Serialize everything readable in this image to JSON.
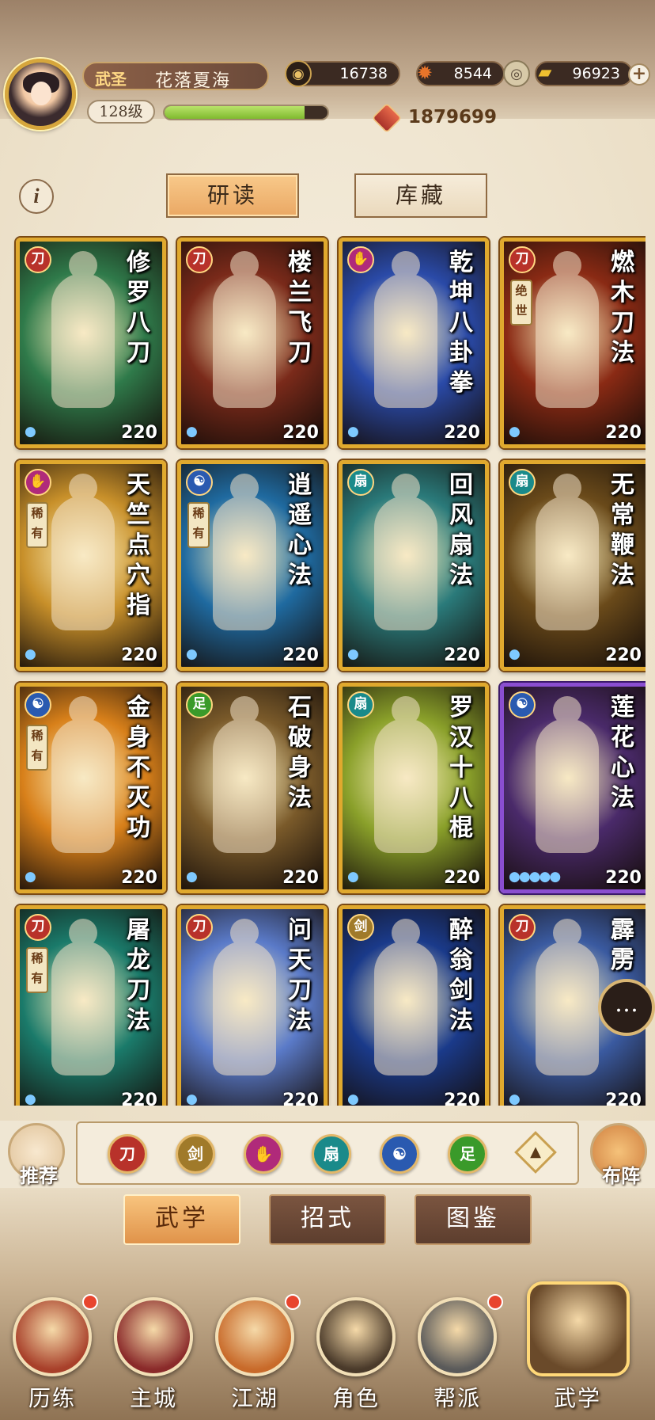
{
  "player": {
    "rank": "武圣",
    "name": "花落夏海",
    "level": "128级",
    "xp_fraction": 0.86,
    "power": "1879699"
  },
  "resources": [
    {
      "icon": "coin-icon",
      "value": "16738"
    },
    {
      "icon": "leaf-icon",
      "value": "8544"
    },
    {
      "icon": "ingot-icon",
      "value": "96923"
    }
  ],
  "plus_label": "+",
  "info_label": "i",
  "tabs": {
    "study": "研读",
    "storage": "库藏"
  },
  "cards": [
    {
      "title": "修罗八刀",
      "level": "220",
      "gem": "sword",
      "gem_color": "#b8322a",
      "art": "#2f7a4a",
      "border": "gold",
      "rare": "",
      "drops": "1"
    },
    {
      "title": "楼兰飞刀",
      "level": "220",
      "gem": "sword",
      "gem_color": "#b8322a",
      "art": "#7a2a1a",
      "border": "gold",
      "rare": "",
      "drops": "1"
    },
    {
      "title": "乾坤八卦拳",
      "level": "220",
      "gem": "fist",
      "gem_color": "#b02a7a",
      "art": "#2a4aa8",
      "border": "gold",
      "rare": "",
      "drops": "1"
    },
    {
      "title": "燃木刀法",
      "level": "220",
      "gem": "sword",
      "gem_color": "#b8322a",
      "art": "#8a2a14",
      "border": "gold",
      "rare": "绝世",
      "drops": "1"
    },
    {
      "title": "天竺点穴指",
      "level": "220",
      "gem": "fist",
      "gem_color": "#b02a7a",
      "art": "#c8902a",
      "border": "gold",
      "rare": "稀有",
      "drops": "1"
    },
    {
      "title": "逍遥心法",
      "level": "220",
      "gem": "yin",
      "gem_color": "#2a5ab0",
      "art": "#1f6aa0",
      "border": "gold",
      "rare": "稀有",
      "drops": "1"
    },
    {
      "title": "回风扇法",
      "level": "220",
      "gem": "fan",
      "gem_color": "#1a8a8a",
      "art": "#2a7a7a",
      "border": "gold",
      "rare": "",
      "drops": "1"
    },
    {
      "title": "无常鞭法",
      "level": "220",
      "gem": "fan",
      "gem_color": "#1a8a8a",
      "art": "#6a4a1a",
      "border": "gold",
      "rare": "",
      "drops": "1"
    },
    {
      "title": "金身不灭功",
      "level": "220",
      "gem": "yin",
      "gem_color": "#2a5ab0",
      "art": "#d8801a",
      "border": "gold",
      "rare": "稀有",
      "drops": "1"
    },
    {
      "title": "石破身法",
      "level": "220",
      "gem": "foot",
      "gem_color": "#3a9a2a",
      "art": "#7a5a2a",
      "border": "gold",
      "rare": "",
      "drops": "1"
    },
    {
      "title": "罗汉十八棍",
      "level": "220",
      "gem": "fan",
      "gem_color": "#1a8a8a",
      "art": "#8aa02a",
      "border": "gold",
      "rare": "",
      "drops": "1"
    },
    {
      "title": "莲花心法",
      "level": "220",
      "gem": "yin",
      "gem_color": "#2a5ab0",
      "art": "#4a2a6a",
      "border": "purple",
      "rare": "",
      "drops": "5"
    },
    {
      "title": "屠龙刀法",
      "level": "220",
      "gem": "sword",
      "gem_color": "#b8322a",
      "art": "#1a7a6a",
      "border": "gold",
      "rare": "稀有",
      "drops": "1"
    },
    {
      "title": "问天刀法",
      "level": "220",
      "gem": "sword",
      "gem_color": "#b8322a",
      "art": "#5a7ac8",
      "border": "gold",
      "rare": "",
      "drops": "1"
    },
    {
      "title": "醉翁剑法",
      "level": "220",
      "gem": "blade",
      "gem_color": "#a07a2a",
      "art": "#1a3a8a",
      "border": "gold",
      "rare": "",
      "drops": "1"
    },
    {
      "title": "霹雳",
      "level": "220",
      "gem": "sword",
      "gem_color": "#b8322a",
      "art": "#3a5aa0",
      "border": "gold",
      "rare": "",
      "drops": "1"
    }
  ],
  "filters": [
    {
      "icon": "sword-filter-icon",
      "color": "#b8322a"
    },
    {
      "icon": "blade-filter-icon",
      "color": "#a07a2a"
    },
    {
      "icon": "fist-filter-icon",
      "color": "#b02a7a"
    },
    {
      "icon": "fan-filter-icon",
      "color": "#1a8a8a"
    },
    {
      "icon": "yinyang-filter-icon",
      "color": "#2a5ab0"
    },
    {
      "icon": "foot-filter-icon",
      "color": "#3a9a2a"
    }
  ],
  "side": {
    "recommend": "推荐",
    "formation": "布阵"
  },
  "subtabs": {
    "martial": "武学",
    "moves": "招式",
    "atlas": "图鉴"
  },
  "nav": [
    {
      "label": "历练",
      "color": "#a8402a",
      "dot": true
    },
    {
      "label": "主城",
      "color": "#8a2a2a",
      "dot": false
    },
    {
      "label": "江湖",
      "color": "#c86a2a",
      "dot": true
    },
    {
      "label": "角色",
      "color": "#4a3a2a",
      "dot": false
    },
    {
      "label": "帮派",
      "color": "#5a5a5a",
      "dot": true
    },
    {
      "label": "武学",
      "color": "#6a4a2a",
      "dot": false
    }
  ]
}
